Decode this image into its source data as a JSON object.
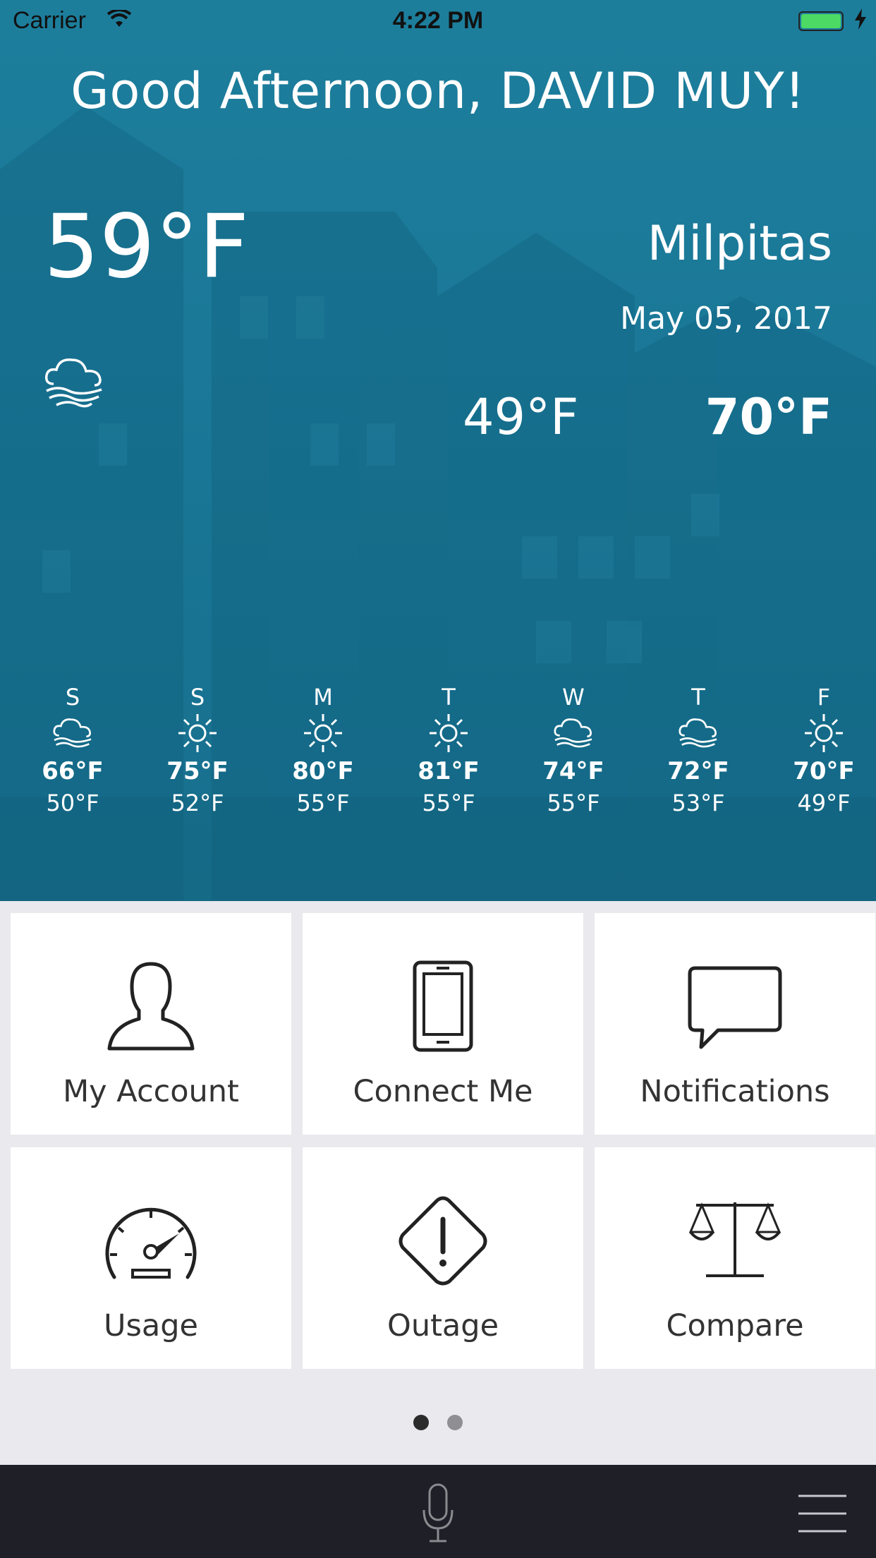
{
  "status_bar": {
    "carrier": "Carrier",
    "time": "4:22 PM"
  },
  "greeting": "Good Afternoon, DAVID MUY!",
  "weather": {
    "current_temp": "59°F",
    "current_icon": "fog-cloud-icon",
    "city": "Milpitas",
    "date": "May 05, 2017",
    "low": "49°F",
    "high": "70°F"
  },
  "forecast": [
    {
      "day": "S",
      "icon": "fog-cloud-icon",
      "high": "66°F",
      "low": "50°F"
    },
    {
      "day": "S",
      "icon": "sun-icon",
      "high": "75°F",
      "low": "52°F"
    },
    {
      "day": "M",
      "icon": "sun-icon",
      "high": "80°F",
      "low": "55°F"
    },
    {
      "day": "T",
      "icon": "sun-icon",
      "high": "81°F",
      "low": "55°F"
    },
    {
      "day": "W",
      "icon": "fog-cloud-icon",
      "high": "74°F",
      "low": "55°F"
    },
    {
      "day": "T",
      "icon": "fog-cloud-icon",
      "high": "72°F",
      "low": "53°F"
    },
    {
      "day": "F",
      "icon": "sun-icon",
      "high": "70°F",
      "low": "49°F"
    }
  ],
  "tiles": [
    {
      "label": "My Account",
      "icon": "user-icon"
    },
    {
      "label": "Connect Me",
      "icon": "phone-icon"
    },
    {
      "label": "Notifications",
      "icon": "chat-bubble-icon"
    },
    {
      "label": "Usage",
      "icon": "speedometer-icon"
    },
    {
      "label": "Outage",
      "icon": "warning-diamond-icon"
    },
    {
      "label": "Compare",
      "icon": "scale-icon"
    }
  ],
  "pager": {
    "pages": 2,
    "current": 1
  },
  "bottom_bar": {
    "mic_icon": "microphone-icon",
    "menu_icon": "hamburger-menu-icon"
  },
  "colors": {
    "hero": "#1b7898",
    "tile_bg": "#ffffff",
    "page_bg": "#e9e9ee",
    "bottom_bar": "#1e1f27",
    "battery": "#4cd964"
  }
}
